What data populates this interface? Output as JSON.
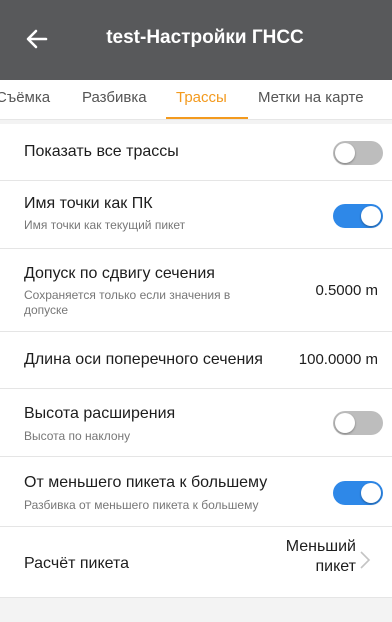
{
  "header": {
    "title": "test-Настройки ГНСС",
    "back_icon": "arrow-left-icon"
  },
  "tabs": [
    {
      "label": "Съёмка",
      "active": false
    },
    {
      "label": "Разбивка",
      "active": false
    },
    {
      "label": "Трассы",
      "active": true
    },
    {
      "label": "Метки на карте",
      "active": false
    }
  ],
  "settings": {
    "show_all_routes": {
      "title": "Показать все трассы",
      "enabled": false
    },
    "point_name_as_pk": {
      "title": "Имя точки как ПК",
      "subtitle": "Имя точки как текущий пикет",
      "enabled": true
    },
    "section_offset_tolerance": {
      "title": "Допуск по сдвигу сечения",
      "subtitle": "Сохраняется только если значения в допуске",
      "value": "0.5000 m"
    },
    "cross_section_axis_length": {
      "title": "Длина оси поперечного сечения",
      "value": "100.0000 m"
    },
    "extension_height": {
      "title": "Высота расширения",
      "subtitle": "Высота по наклону",
      "enabled": false
    },
    "smaller_to_larger": {
      "title": "От меньшего пикета к большему",
      "subtitle": "Разбивка от меньшего пикета к большему",
      "enabled": true
    },
    "station_calc": {
      "title": "Расчёт пикета",
      "value_line1": "Меньший",
      "value_line2": "пикет"
    }
  },
  "colors": {
    "accent": "#f39a1e",
    "toggle_on": "#2e88e8",
    "toggle_off": "#bdbdbd",
    "header_bg": "#58595b"
  }
}
